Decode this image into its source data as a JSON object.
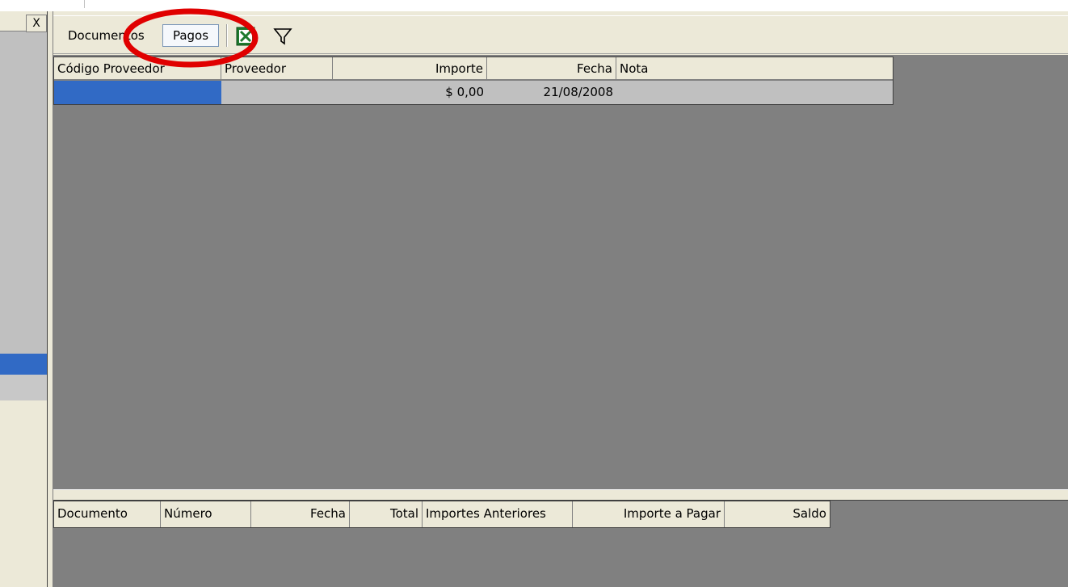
{
  "left_panel": {
    "close_label": "X"
  },
  "toolbar": {
    "tabs": [
      {
        "label": "Documentos"
      },
      {
        "label": "Pagos"
      }
    ],
    "icons": [
      "excel-export-icon",
      "filter-icon"
    ]
  },
  "payments_grid": {
    "columns": [
      "Código Proveedor",
      "Proveedor",
      "Importe",
      "Fecha",
      "Nota"
    ],
    "rows": [
      {
        "codigo": "",
        "proveedor": "",
        "importe": "$ 0,00",
        "fecha": "21/08/2008",
        "nota": ""
      }
    ]
  },
  "detail_grid": {
    "columns": [
      "Documento",
      "Número",
      "Fecha",
      "Total",
      "Importes Anteriores",
      "Importe a Pagar",
      "Saldo"
    ]
  },
  "colors": {
    "selection": "#316ac5",
    "grid_background": "#808080",
    "annotation": "#e00000",
    "window_face": "#ece9d8"
  }
}
